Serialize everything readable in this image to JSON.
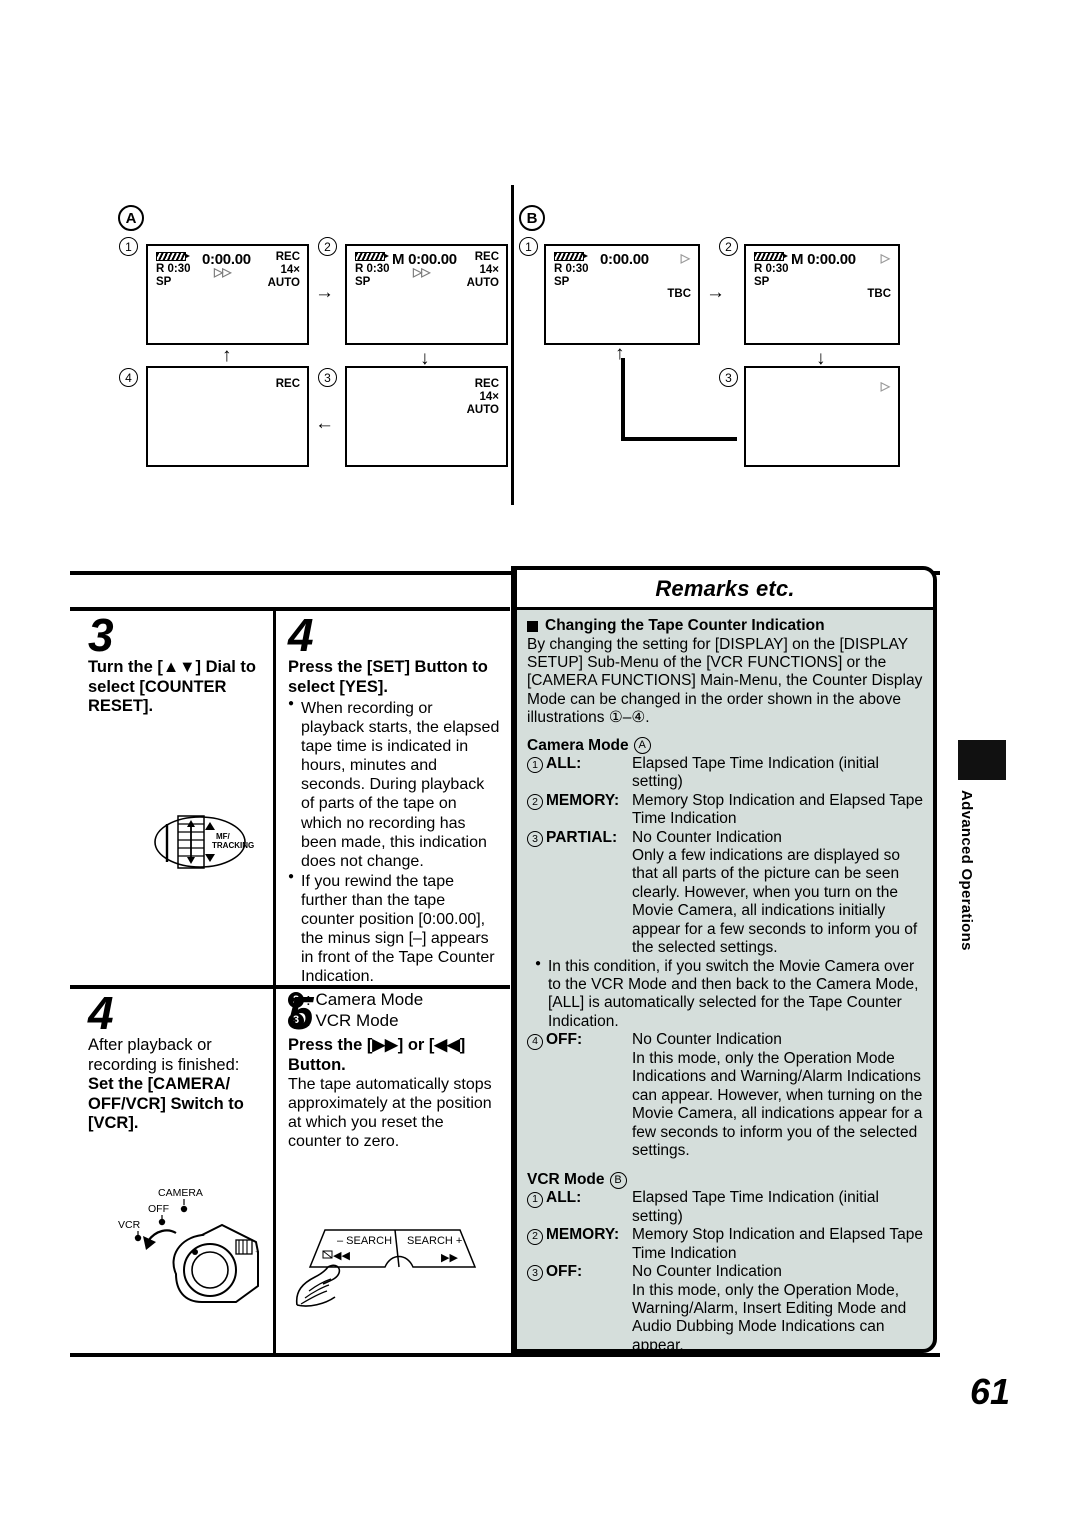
{
  "diagram": {
    "group_a_label": "A",
    "group_b_label": "B",
    "arrow_right": "→",
    "arrow_down": "↓",
    "arrow_up": "↑",
    "arrow_left": "←",
    "screens_a": [
      {
        "num": "1",
        "battery": "R 0:30",
        "speed": "SP",
        "counter": "0:00.00",
        "play": "▷▷",
        "right": [
          "REC",
          "14×",
          "AUTO"
        ]
      },
      {
        "num": "2",
        "battery": "R 0:30",
        "speed": "SP",
        "counter": "M 0:00.00",
        "play": "▷▷",
        "right": [
          "REC",
          "14×",
          "AUTO"
        ]
      },
      {
        "num": "3",
        "battery": "",
        "speed": "",
        "counter": "",
        "play": "",
        "right": [
          "REC",
          "14×",
          "AUTO"
        ]
      },
      {
        "num": "4",
        "battery": "",
        "speed": "",
        "counter": "",
        "play": "",
        "right": [
          "REC"
        ]
      }
    ],
    "screens_b": [
      {
        "num": "1",
        "battery": "R 0:30",
        "speed": "SP",
        "counter": "0:00.00",
        "play": "▷",
        "tbc": "TBC"
      },
      {
        "num": "2",
        "battery": "R 0:30",
        "speed": "SP",
        "counter": "M 0:00.00",
        "play": "▷",
        "tbc": "TBC"
      },
      {
        "num": "3",
        "battery": "",
        "speed": "",
        "counter": "",
        "play": "▷",
        "tbc": ""
      }
    ]
  },
  "steps": {
    "step3": {
      "number": "3",
      "heading": "Turn the [▲▼] Dial to select [COUNTER RESET].",
      "dial_label_line1": "MF/",
      "dial_label_line2": "TRACKING"
    },
    "step4_top": {
      "number": "4",
      "heading": "Press the [SET] Button to select [YES].",
      "bullet1": "When recording or playback starts, the elapsed tape time is indicated in hours, minutes and seconds. During playback of parts of the tape on which no recording has been made, this indication does not change.",
      "bullet2": "If you rewind the tape further than the tape counter position [0:00.00], the minus sign [–] appears in front of the Tape Counter Indication.",
      "mode2_num": "2",
      "mode2_text": ": Camera Mode",
      "mode3_num": "3",
      "mode3_text": ": VCR Mode"
    },
    "step4_bottom": {
      "number": "4",
      "intro": "After playback or recording is finished:",
      "heading": "Set the [CAMERA/ OFF/VCR] Switch to [VCR].",
      "switch_camera": "CAMERA",
      "switch_off": "OFF",
      "switch_vcr": "VCR"
    },
    "step5": {
      "number": "5",
      "heading": "Press the [▶▶] or [◀◀] Button.",
      "body": "The tape automatically stops approximately at the position at which you reset the counter to zero.",
      "btn_left_label": "– SEARCH",
      "btn_right_label": "SEARCH +",
      "btn_left_icon": "◀◀",
      "btn_right_icon": "▶▶"
    }
  },
  "remarks": {
    "title": "Remarks etc.",
    "section_heading": "Changing the Tape Counter Indication",
    "intro": "By changing the setting for [DISPLAY] on the [DISPLAY SETUP] Sub-Menu of the [VCR FUNCTIONS] or the [CAMERA FUNCTIONS] Main-Menu, the Counter Display Mode can be changed in the order shown in the above illustrations ①–④.",
    "camera_mode_label": "Camera Mode",
    "camera_mode_badge": "A",
    "camera_rows": [
      {
        "n": "1",
        "label": "ALL:",
        "text": "Elapsed Tape Time Indication (initial setting)"
      },
      {
        "n": "2",
        "label": "MEMORY:",
        "text": "Memory Stop Indication and Elapsed Tape Time Indication"
      },
      {
        "n": "3",
        "label": "PARTIAL:",
        "text": "No Counter Indication"
      }
    ],
    "partial_cont": "Only a few indications are displayed so that all parts of the picture can be seen clearly. However, when you turn on the Movie Camera, all indications initially appear for a few seconds to inform you of the selected settings.",
    "partial_bullet": "In this condition, if you switch the Movie Camera over to the VCR Mode and then back to the Camera Mode, [ALL] is automatically selected for the Tape Counter Indication.",
    "off_row": {
      "n": "4",
      "label": "OFF:",
      "text": "No Counter Indication"
    },
    "off_cont": "In this mode, only the Operation Mode Indications and Warning/Alarm Indications can appear. However, when turning on the Movie Camera, all indications appear for a few seconds to inform you of the selected settings.",
    "vcr_mode_label": "VCR Mode",
    "vcr_mode_badge": "B",
    "vcr_rows": [
      {
        "n": "1",
        "label": "ALL:",
        "text": "Elapsed Tape Time Indication (initial setting)"
      },
      {
        "n": "2",
        "label": "MEMORY:",
        "text": "Memory Stop Indication and Elapsed Tape Time Indication"
      },
      {
        "n": "3",
        "label": "OFF:",
        "text": "No Counter Indication"
      }
    ],
    "vcr_off_cont": "In this mode, only the Operation Mode, Warning/Alarm, Insert Editing Mode and Audio Dubbing Mode Indications can appear."
  },
  "side_tab": {
    "label": "Advanced Operations"
  },
  "page_number": "61"
}
